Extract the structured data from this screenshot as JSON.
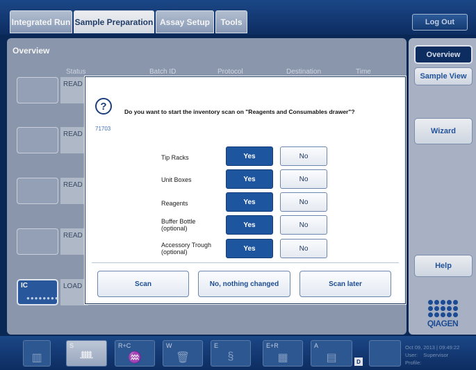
{
  "tabs": [
    {
      "label": "Integrated Run"
    },
    {
      "label": "Sample Preparation"
    },
    {
      "label": "Assay Setup"
    },
    {
      "label": "Tools"
    }
  ],
  "logout_label": "Log Out",
  "main": {
    "title": "Overview",
    "columns": [
      "Status",
      "Batch ID",
      "Protocol",
      "Destination",
      "Time"
    ],
    "slots": [
      {
        "status": "READ"
      },
      {
        "status": "READ"
      },
      {
        "status": "READ"
      },
      {
        "status": "READ"
      },
      {
        "label": "IC",
        "status": "LOAD"
      }
    ]
  },
  "sidebar": {
    "overview": "Overview",
    "sample_view": "Sample View",
    "wizard": "Wizard",
    "help": "Help"
  },
  "brand": "QIAGEN",
  "dialog": {
    "code": "71703",
    "question": "Do you want to start the inventory scan on \"Reagents and Consumables drawer\"?",
    "rows": [
      {
        "label": "Tip Racks",
        "yes": "Yes",
        "no": "No"
      },
      {
        "label": "Unit Boxes",
        "yes": "Yes",
        "no": "No"
      },
      {
        "label": "Reagents",
        "yes": "Yes",
        "no": "No"
      },
      {
        "label": "Buffer Bottle\n(optional)",
        "yes": "Yes",
        "no": "No"
      },
      {
        "label": "Accessory Trough\n(optional)",
        "yes": "Yes",
        "no": "No"
      }
    ],
    "actions": {
      "scan": "Scan",
      "no_change": "No, nothing changed",
      "scan_later": "Scan later"
    }
  },
  "drawers": [
    {
      "label": ""
    },
    {
      "label": "S"
    },
    {
      "label": "R+C"
    },
    {
      "label": "W"
    },
    {
      "label": "E"
    },
    {
      "label": "E+R"
    },
    {
      "label": "A"
    },
    {
      "label": ""
    }
  ],
  "drawer_badge": "D",
  "status_info": {
    "datetime": "Oct 09, 2013 | 09:49:22",
    "user_label": "User:",
    "user": "Supervisor",
    "profile_label": "Profile:"
  }
}
